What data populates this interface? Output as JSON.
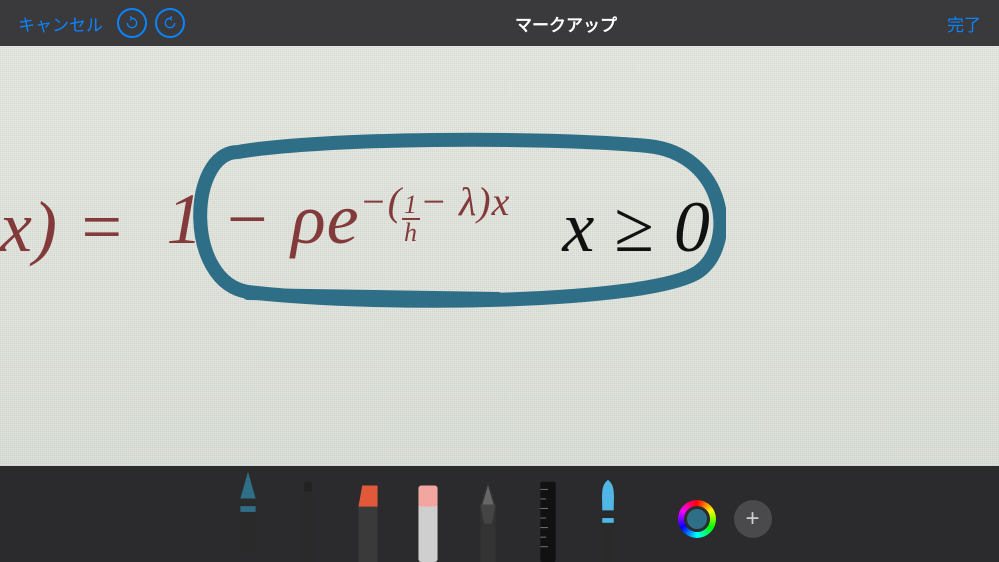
{
  "header": {
    "cancel_label": "キャンセル",
    "title": "マークアップ",
    "done_label": "完了"
  },
  "formula": {
    "lhs": "x) =",
    "circled_plain": "1 − ρe",
    "exp_prefix": "−(",
    "frac_num": "1",
    "frac_den": "h",
    "exp_suffix": "− λ)x",
    "rhs_var": "x",
    "rhs_op": "≥",
    "rhs_val": "0"
  },
  "annotation": {
    "stroke_color": "#2f6e87"
  },
  "tools": [
    {
      "name": "pen",
      "tip_color": "#2f6e87",
      "body_color": "#2a2a2a",
      "selected": true
    },
    {
      "name": "marker",
      "tip_color": "#222",
      "body_color": "#2a2a2a",
      "selected": false
    },
    {
      "name": "highlighter",
      "tip_color": "#e1593a",
      "body_color": "#3a3a3a",
      "selected": false
    },
    {
      "name": "eraser",
      "tip_color": "#f2a6a0",
      "body_color": "#cfcfcf",
      "selected": false
    },
    {
      "name": "pencil",
      "tip_color": "#555",
      "body_color": "#333",
      "selected": false
    },
    {
      "name": "ruler",
      "tip_color": "#111",
      "body_color": "#111",
      "selected": false
    },
    {
      "name": "brush",
      "tip_color": "#4fb6e6",
      "body_color": "#2a2a2a",
      "selected": false
    }
  ],
  "color_picker": {
    "current": "#2f6e87"
  },
  "add_button": {
    "glyph": "+"
  }
}
